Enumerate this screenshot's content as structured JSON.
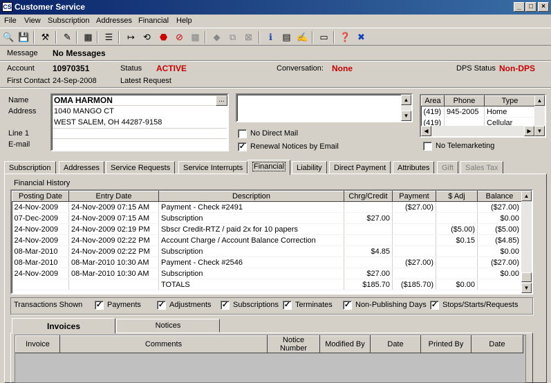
{
  "window": {
    "title": "Customer Service"
  },
  "menu": [
    "File",
    "View",
    "Subscription",
    "Addresses",
    "Financial",
    "Help"
  ],
  "toolbar_icons": [
    "search-icon",
    "save-icon",
    "tools-icon",
    "edit-icon",
    "calendar-icon",
    "notepad-icon",
    "arrow-right-icon",
    "return-icon",
    "stop-icon",
    "cancel-icon",
    "grid-icon",
    "diamond-icon",
    "copy-icon",
    "delete-icon",
    "info-icon",
    "document-icon",
    "sign-icon",
    "card-icon",
    "help-icon",
    "close-icon"
  ],
  "message": {
    "label": "Message",
    "value": "No Messages"
  },
  "account": {
    "label": "Account",
    "number": "10970351",
    "status_label": "Status",
    "status": "ACTIVE",
    "conversation_label": "Conversation:",
    "conversation": "None",
    "dps_label": "DPS Status",
    "dps": "Non-DPS",
    "first_contact_label": "First Contact",
    "first_contact": "24-Sep-2008",
    "latest_request_label": "Latest Request"
  },
  "customer": {
    "name_label": "Name",
    "name": "OMA HARMON",
    "address_label": "Address",
    "address1": "1040 MANGO CT",
    "address2": "WEST SALEM, OH  44287-9158",
    "line1_label": "Line 1",
    "email_label": "E-mail",
    "browse_label": "..."
  },
  "options": {
    "no_direct_mail": "No Direct Mail",
    "renewal_notices": "Renewal Notices by Email",
    "no_telemarketing": "No Telemarketing"
  },
  "phones": {
    "headers": [
      "Area",
      "Phone",
      "Type"
    ],
    "rows": [
      {
        "area": "(419)",
        "phone": "945-2005",
        "type": "Home"
      },
      {
        "area": "(419)",
        "phone": "",
        "type": "Cellular"
      }
    ]
  },
  "tabs": [
    "Subscription",
    "Addresses",
    "Service Requests",
    "Service Interrupts",
    "Financial",
    "Liability",
    "Direct Payment",
    "Attributes",
    "Gift",
    "Sales Tax"
  ],
  "history": {
    "title": "Financial History",
    "headers": [
      "Posting Date",
      "Entry Date",
      "Description",
      "Chrg/Credit",
      "Payment",
      "$ Adj",
      "Balance"
    ],
    "rows": [
      [
        "24-Nov-2009",
        "24-Nov-2009 07:15 AM",
        "Payment - Check #2491",
        "",
        "($27.00)",
        "",
        "($27.00)"
      ],
      [
        "07-Dec-2009",
        "24-Nov-2009 07:15 AM",
        "Subscription",
        "$27.00",
        "",
        "",
        "$0.00"
      ],
      [
        "24-Nov-2009",
        "24-Nov-2009 02:19 PM",
        "Sbscr Credit-RTZ / paid 2x for 10 papers",
        "",
        "",
        "($5.00)",
        "($5.00)"
      ],
      [
        "24-Nov-2009",
        "24-Nov-2009 02:22 PM",
        "Account Charge / Account Balance Correction",
        "",
        "",
        "$0.15",
        "($4.85)"
      ],
      [
        "08-Mar-2010",
        "24-Nov-2009 02:22 PM",
        "Subscription",
        "$4.85",
        "",
        "",
        "$0.00"
      ],
      [
        "08-Mar-2010",
        "08-Mar-2010 10:30 AM",
        "Payment - Check #2546",
        "",
        "($27.00)",
        "",
        "($27.00)"
      ],
      [
        "24-Nov-2009",
        "08-Mar-2010 10:30 AM",
        "Subscription",
        "$27.00",
        "",
        "",
        "$0.00"
      ],
      [
        "",
        "",
        "TOTALS",
        "$185.70",
        "($185.70)",
        "$0.00",
        ""
      ]
    ]
  },
  "transactions": {
    "label": "Transactions Shown",
    "filters": [
      "Payments",
      "Adjustments",
      "Subscriptions",
      "Terminates",
      "Non-Publishing Days",
      "Stops/Starts/Requests"
    ]
  },
  "subtabs": [
    "Invoices",
    "Notices"
  ],
  "invoices": {
    "headers": [
      "Invoice",
      "Comments",
      "Notice Number",
      "Modified By",
      "Date",
      "Printed By",
      "Date"
    ]
  },
  "colors": {
    "title_start": "#0a246a",
    "title_end": "#3a6ea5",
    "status_red": "#cc0000",
    "face": "#d4d0c8"
  }
}
